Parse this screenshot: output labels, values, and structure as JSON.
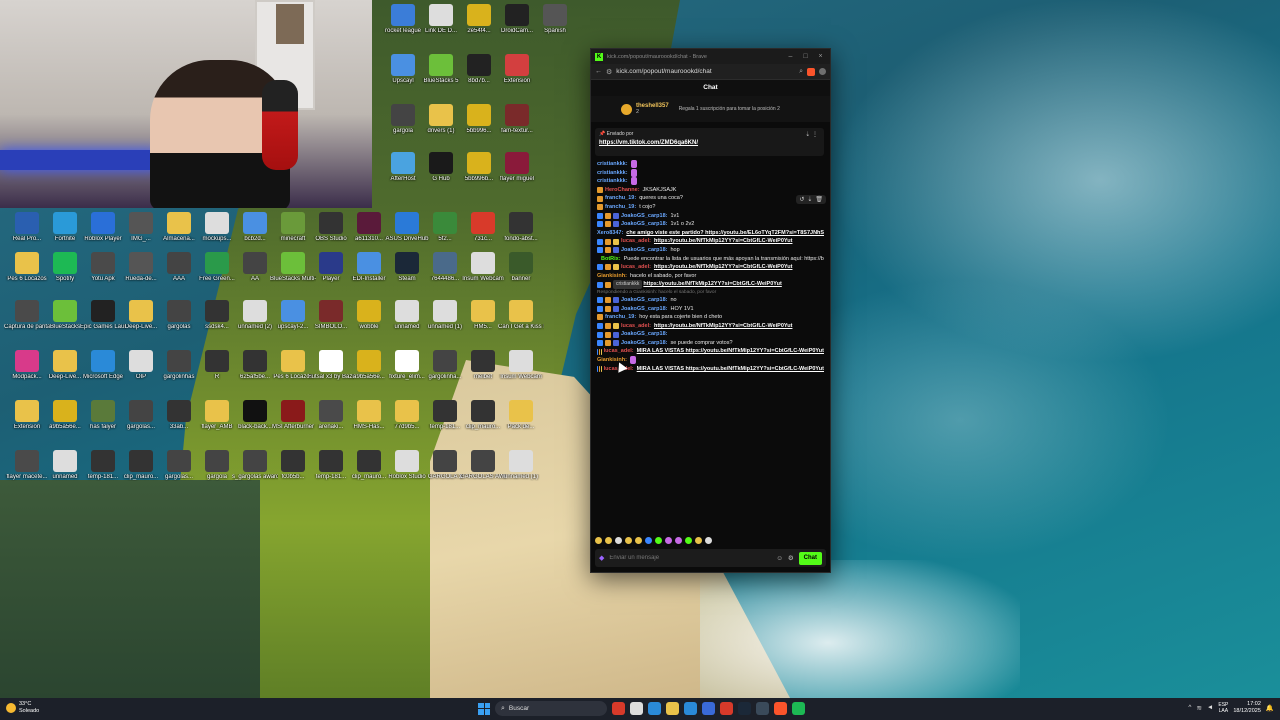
{
  "webcam": {
    "label": "streamer webcam"
  },
  "desktop_icons": [
    {
      "label": "rocket league",
      "color": "#3b7dd8"
    },
    {
      "label": "Link DE D...",
      "color": "#dddddd"
    },
    {
      "label": "2e54f4...",
      "color": "#d9b21c"
    },
    {
      "label": "DroidCam...",
      "color": "#222222"
    },
    {
      "label": "Spanish",
      "color": "#555555"
    },
    {
      "label": "Upscayl",
      "color": "#4a90e2"
    },
    {
      "label": "BlueStacks 5",
      "color": "#6cbf3a"
    },
    {
      "label": "8bd7b...",
      "color": "#222222"
    },
    {
      "label": "Extension",
      "color": "#d33f3f"
    },
    {
      "label": "gargola",
      "color": "#444444"
    },
    {
      "label": "drivers (1)",
      "color": "#e9c24a"
    },
    {
      "label": "5bb996...",
      "color": "#d9b21c"
    },
    {
      "label": "fam-textur...",
      "color": "#7a2a2a"
    },
    {
      "label": "AfterHost",
      "color": "#4aa3e0"
    },
    {
      "label": "G Hub",
      "color": "#1a1a1a"
    },
    {
      "label": "5bb996b...",
      "color": "#d9b21c"
    },
    {
      "label": "flayer miguel",
      "color": "#8a1a3a"
    },
    {
      "label": "Real Pro...",
      "color": "#2a5fb0"
    },
    {
      "label": "Fortnite",
      "color": "#2a9ad8"
    },
    {
      "label": "Roblox Player",
      "color": "#2a6fd8"
    },
    {
      "label": "IMG_...",
      "color": "#555555"
    },
    {
      "label": "Almacena...",
      "color": "#e9c24a"
    },
    {
      "label": "mockups...",
      "color": "#dddddd"
    },
    {
      "label": "bcb2d...",
      "color": "#4a90e2"
    },
    {
      "label": "minecraft",
      "color": "#6a9a3a"
    },
    {
      "label": "OBS Studio",
      "color": "#333333"
    },
    {
      "label": "a611310...",
      "color": "#5a1a3a"
    },
    {
      "label": "ASUS DriveHub",
      "color": "#2a7ad8"
    },
    {
      "label": "5f2...",
      "color": "#3a8a3a"
    },
    {
      "label": "731c...",
      "color": "#d83a2a"
    },
    {
      "label": "fondo-abst...",
      "color": "#333333"
    },
    {
      "label": "Pes 6 Locazos",
      "color": "#e9c24a"
    },
    {
      "label": "Spotify",
      "color": "#1db954"
    },
    {
      "label": "Yotu Apk",
      "color": "#4a4a4a"
    },
    {
      "label": "Rueda-de...",
      "color": "#555555"
    },
    {
      "label": "AAA",
      "color": "#444444"
    },
    {
      "label": "Free Green...",
      "color": "#2a9a4a"
    },
    {
      "label": "AA",
      "color": "#444444"
    },
    {
      "label": "BlueStacks Multi-Insta...",
      "color": "#6cbf3a"
    },
    {
      "label": "Player",
      "color": "#2a3a8a"
    },
    {
      "label": "EDI-Installer",
      "color": "#4a90e2"
    },
    {
      "label": "Steam",
      "color": "#1b2838"
    },
    {
      "label": "7644486...",
      "color": "#4a6a8a"
    },
    {
      "label": "Insum Webcam",
      "color": "#dddddd"
    },
    {
      "label": "banner",
      "color": "#3a5a2a"
    },
    {
      "label": "Captura de pantalla",
      "color": "#4a4a4a"
    },
    {
      "label": "BlueStacks",
      "color": "#6cbf3a"
    },
    {
      "label": "Epic Games Launcher",
      "color": "#222222"
    },
    {
      "label": "Deep-Live...",
      "color": "#e9c24a"
    },
    {
      "label": "gargolas",
      "color": "#444444"
    },
    {
      "label": "ssdsk4...",
      "color": "#333333"
    },
    {
      "label": "unnamed (2)",
      "color": "#dddddd"
    },
    {
      "label": "upscayl-2...",
      "color": "#4a90e2"
    },
    {
      "label": "SIMBOLO...",
      "color": "#7a2a2a"
    },
    {
      "label": "wobble",
      "color": "#d9b21c"
    },
    {
      "label": "unnamed",
      "color": "#dddddd"
    },
    {
      "label": "unnamed (1)",
      "color": "#dddddd"
    },
    {
      "label": "HM5...",
      "color": "#e9c24a"
    },
    {
      "label": "Can I Get a Kiss Mauroo",
      "color": "#e9c24a"
    },
    {
      "label": "Modpack...",
      "color": "#d83a8a"
    },
    {
      "label": "Deep-Live...",
      "color": "#e9c24a"
    },
    {
      "label": "Microsoft Edge",
      "color": "#2a8ad8"
    },
    {
      "label": "OIP",
      "color": "#dddddd"
    },
    {
      "label": "gargolinhas",
      "color": "#444444"
    },
    {
      "label": "R",
      "color": "#333333"
    },
    {
      "label": "625af5be...",
      "color": "#333333"
    },
    {
      "label": "Pes 6 Locazos",
      "color": "#e9c24a"
    },
    {
      "label": "Futsal x3 by Bazinga fro...",
      "color": "#ffffff"
    },
    {
      "label": "a9b5a56e...",
      "color": "#d9b21c"
    },
    {
      "label": "fixture_elim...",
      "color": "#ffffff"
    },
    {
      "label": "gargolinha...",
      "color": "#444444"
    },
    {
      "label": "melbet",
      "color": "#333333"
    },
    {
      "label": "Insum Webcam",
      "color": "#dddddd"
    },
    {
      "label": "Extension",
      "color": "#e9c24a"
    },
    {
      "label": "a9b5a56e...",
      "color": "#d9b21c"
    },
    {
      "label": "has faiyer",
      "color": "#5a7a3a"
    },
    {
      "label": "gargolas...",
      "color": "#444444"
    },
    {
      "label": "33ab...",
      "color": "#333333"
    },
    {
      "label": "flayer_AMB",
      "color": "#e9c24a"
    },
    {
      "label": "black-back...",
      "color": "#111111"
    },
    {
      "label": "MSI Afterburner",
      "color": "#8a1a1a"
    },
    {
      "label": "arenaki...",
      "color": "#4a4a4a"
    },
    {
      "label": "HMS-Has...",
      "color": "#e9c24a"
    },
    {
      "label": "77d9b5...",
      "color": "#e9c24a"
    },
    {
      "label": "temp-181...",
      "color": "#333333"
    },
    {
      "label": "clip_mauro...",
      "color": "#333333"
    },
    {
      "label": "Pack de...",
      "color": "#e9c24a"
    },
    {
      "label": "flayer macete...",
      "color": "#4a4a4a"
    },
    {
      "label": "unnamed",
      "color": "#dddddd"
    },
    {
      "label": "temp-181...",
      "color": "#333333"
    },
    {
      "label": "clip_mauro...",
      "color": "#333333"
    },
    {
      "label": "gargolas...",
      "color": "#444444"
    },
    {
      "label": "gargola",
      "color": "#444444"
    },
    {
      "label": "s_gargolas awards",
      "color": "#444444"
    },
    {
      "label": "fc0b5b...",
      "color": "#333333"
    },
    {
      "label": "temp-181...",
      "color": "#333333"
    },
    {
      "label": "clip_mauro...",
      "color": "#333333"
    },
    {
      "label": "Roblox Studio",
      "color": "#dddddd"
    },
    {
      "label": "GARGOLA 3",
      "color": "#444444"
    },
    {
      "label": "GARGOLAS AWARDS",
      "color": "#444444"
    },
    {
      "label": "unnamed (1)",
      "color": "#dddddd"
    }
  ],
  "browser": {
    "window_title": "kick.com/popout/mauroookd/chat - Brave",
    "url": "kick.com/popout/mauroookd/chat",
    "back_icon": "back-arrow-icon",
    "brave_icon": "brave-lion-icon"
  },
  "chat": {
    "header": "Chat",
    "sub_banner": {
      "username": "theshell357",
      "count": "2",
      "gift_text": "Regala 1 suscripción para tomar la posición 2"
    },
    "pinned": {
      "sent_by": "Enviado por",
      "link": "https://vm.tiktok.com/ZMD6qa6KN/"
    },
    "hover_actions": [
      "↺",
      "⇣",
      "🗑"
    ],
    "messages": [
      {
        "user": "cristiankkk:",
        "ucolor": "#6aa8ff",
        "text": "",
        "emote": true,
        "badges": []
      },
      {
        "user": "cristiankkk:",
        "ucolor": "#6aa8ff",
        "text": "",
        "emote": true,
        "badges": []
      },
      {
        "user": "cristiankkk:",
        "ucolor": "#6aa8ff",
        "text": "",
        "emote": true,
        "badges": []
      },
      {
        "user": "HeroChanne:",
        "ucolor": "#e05050",
        "text": "JKSAKJSAJK",
        "badges": [
          "#e59a2d"
        ]
      },
      {
        "user": "franchu_19:",
        "ucolor": "#6aa8ff",
        "text": "queres una coca?",
        "badges": [
          "#e59a2d"
        ]
      },
      {
        "user": "franchu_19:",
        "ucolor": "#6aa8ff",
        "text": "t cojo?",
        "badges": [
          "#e59a2d"
        ]
      },
      {
        "user": "JoakoGS_carp18:",
        "ucolor": "#6aa8ff",
        "text": "1v1",
        "badges": [
          "#3a86ff",
          "#e59a2d",
          "#4a64d8"
        ]
      },
      {
        "user": "JoakoGS_carp18:",
        "ucolor": "#6aa8ff",
        "text": "1v1 o 2v2",
        "badges": [
          "#3a86ff",
          "#e59a2d",
          "#4a64d8"
        ]
      },
      {
        "user": "Xero8347:",
        "ucolor": "#6aa8ff",
        "text": "che amigo viste este partido? https://youtu.be/EL6oTYqT2FM?si=T8S7JNhSnCsRc",
        "link": true,
        "badges": []
      },
      {
        "user": "lucas_adel:",
        "ucolor": "#e05050",
        "text": "https://youtu.be/NfTkMip12YY?si=CbtGfLC-WeiP0Yut",
        "link": true,
        "badges": [
          "#3a86ff",
          "#e59a2d",
          "#e9c24a"
        ]
      },
      {
        "user": "JoakoGS_carp18:",
        "ucolor": "#6aa8ff",
        "text": "hop",
        "badges": [
          "#3a86ff",
          "#e59a2d",
          "#4a64d8"
        ]
      },
      {
        "user": "BotRix:",
        "ucolor": "#53fc18",
        "text": "Puede encontrar la lista de usuarios que más apoyan la transmisión aquí: https://botrix.live/k/mauroookd/leaderboard",
        "badges": [
          "#3a86ff",
          "#53fc18"
        ]
      },
      {
        "user": "lucas_adel:",
        "ucolor": "#e05050",
        "text": "https://youtu.be/NfTkMip12YY?si=CbtGfLC-WeiP0Yut",
        "link": true,
        "badges": [
          "#3a86ff",
          "#e59a2d",
          "#e9c24a"
        ]
      },
      {
        "user": "Giankisinh:",
        "ucolor": "#e59a2d",
        "text": "hacelo el sabado, por favor",
        "badges": []
      },
      {
        "user": "cristiankkk",
        "ucolor": "#cccccc",
        "text": "https://youtu.be/NfTkMip12YY?si=CbtGfLC-WeiP0Yut",
        "link": true,
        "chip": true,
        "badges": [
          "#3a86ff",
          "#e59a2d"
        ]
      },
      {
        "reply": "Respondiendo a Giankisinh: hacelo el sabado, por favor"
      },
      {
        "user": "JoakoGS_carp18:",
        "ucolor": "#6aa8ff",
        "text": "no",
        "badges": [
          "#3a86ff",
          "#e59a2d",
          "#4a64d8"
        ]
      },
      {
        "user": "JoakoGS_carp18:",
        "ucolor": "#6aa8ff",
        "text": "HOY 1V1",
        "badges": [
          "#3a86ff",
          "#e59a2d",
          "#4a64d8"
        ]
      },
      {
        "user": "franchu_19:",
        "ucolor": "#6aa8ff",
        "text": "hoy esta para cojerte bien d cheto",
        "badges": [
          "#e59a2d"
        ]
      },
      {
        "user": "lucas_adel:",
        "ucolor": "#e05050",
        "text": "https://youtu.be/NfTkMip12YY?si=CbtGfLC-WeiP0Yut",
        "link": true,
        "badges": [
          "#3a86ff",
          "#e59a2d",
          "#e9c24a"
        ]
      },
      {
        "user": "JoakoGS_carp18:",
        "ucolor": "#6aa8ff",
        "text": "",
        "badges": [
          "#3a86ff",
          "#e59a2d",
          "#4a64d8"
        ]
      },
      {
        "user": "JoakoGS_carp18:",
        "ucolor": "#6aa8ff",
        "text": "se puede comprar votos?",
        "badges": [
          "#3a86ff",
          "#e59a2d",
          "#4a64d8"
        ]
      },
      {
        "user": "lucas_adel:",
        "ucolor": "#e05050",
        "text": "MIRA LAS VISTAS https://youtu.be/NfTkMip12YY?si=CbtGfLC-WeiP0Yut",
        "link": true,
        "badges": [
          "#3a86ff",
          "#e59a2d",
          "#e9c24a"
        ]
      },
      {
        "user": "Giankisinh:",
        "ucolor": "#e59a2d",
        "text": "",
        "emote": true,
        "badges": []
      },
      {
        "user": "lucas_adel:",
        "ucolor": "#e05050",
        "text": "MIRA LAS VISTAS https://youtu.be/NfTkMip12YY?si=CbtGfLC-WeiP0Yut",
        "link": true,
        "badges": [
          "#3a86ff",
          "#e59a2d",
          "#e9c24a"
        ]
      }
    ],
    "emote_bar_colors": [
      "#e9c24a",
      "#e9c24a",
      "#dddddd",
      "#e9c24a",
      "#e9c24a",
      "#3a86ff",
      "#53fc18",
      "#c76ae6",
      "#c76ae6",
      "#53fc18",
      "#e9c24a",
      "#dddddd"
    ],
    "input_placeholder": "Enviar un mensaje",
    "send_label": "Chat",
    "accent": "#53fc18"
  },
  "taskbar": {
    "weather_temp": "33°C",
    "weather_desc": "Soleado",
    "search_placeholder": "Buscar",
    "lang_top": "ESP",
    "lang_bottom": "LAA",
    "time": "17:02",
    "date": "18/12/2025",
    "apps": [
      "#d83a2a",
      "#dddddd",
      "#2a8ad8",
      "#e9c24a",
      "#2a8ad8",
      "#3a6ad8",
      "#d83a2a",
      "#1b2838",
      "#3a4a5a",
      "#fb542b",
      "#1db954"
    ]
  }
}
